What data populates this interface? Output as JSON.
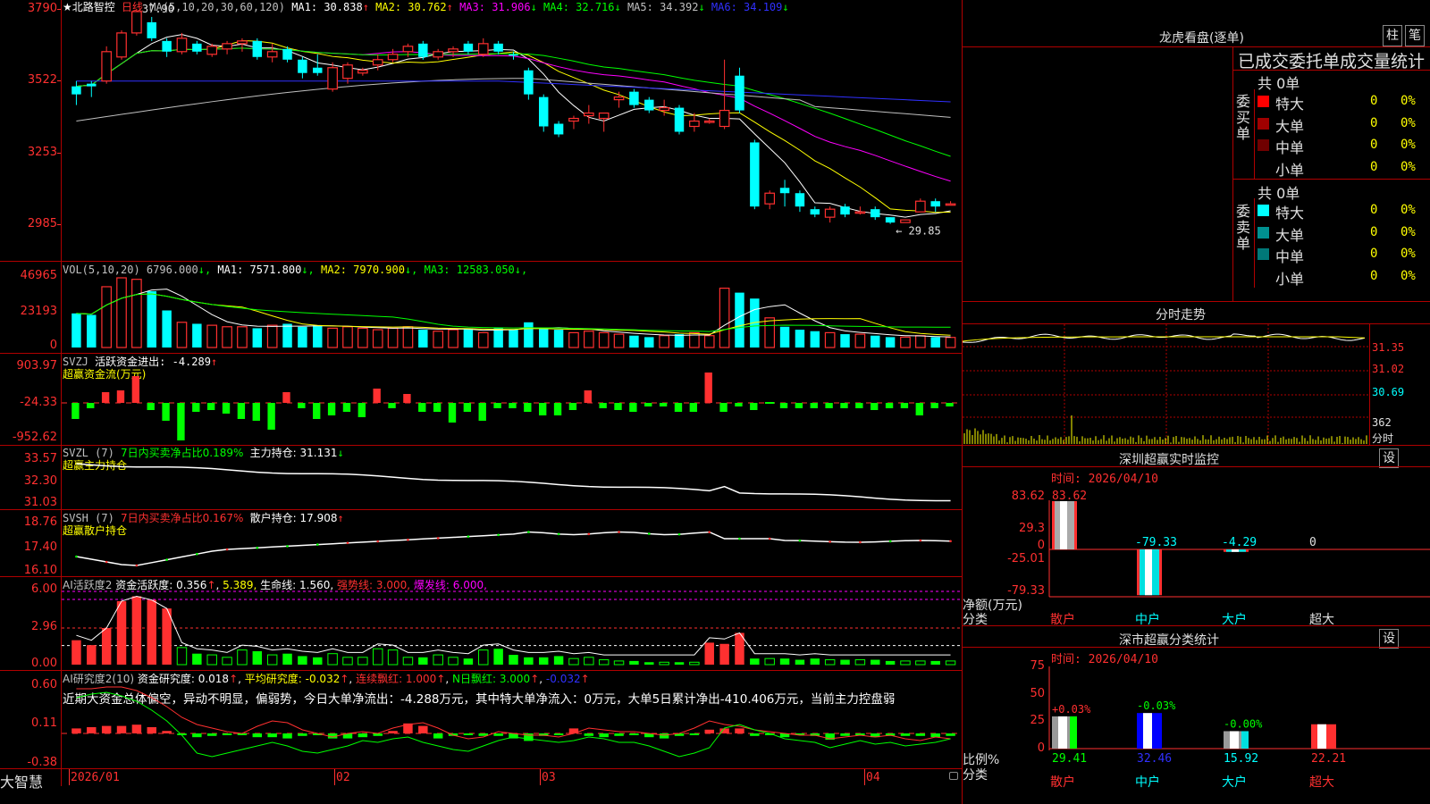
{
  "header": {
    "stock": "★北路智控",
    "period": "日线",
    "ma_label": "MA(5,10,20,30,60,120)",
    "ma": [
      {
        "name": "MA1: 30.838",
        "arrow": "↑",
        "color": "#ffffff"
      },
      {
        "name": "MA2: 30.762",
        "arrow": "↑",
        "color": "#ffff00"
      },
      {
        "name": "MA3: 31.906",
        "arrow": "↓",
        "color": "#ff00ff"
      },
      {
        "name": "MA4: 32.716",
        "arrow": "↓",
        "color": "#00ff00"
      },
      {
        "name": "MA5: 34.392",
        "arrow": "↓",
        "color": "#c0c0c0"
      },
      {
        "name": "MA6: 34.109",
        "arrow": "↓",
        "color": "#3030ff"
      }
    ]
  },
  "colors": {
    "up": "#ff3030",
    "down": "#00ffff",
    "panel_line": "#b00000",
    "green": "#00ff00"
  },
  "price_panel": {
    "ticks": [
      "3790",
      "3522",
      "3253",
      "2985"
    ],
    "tick_values": [
      37.9,
      35.22,
      32.53,
      29.85
    ],
    "ylim": [
      28.8,
      38.1
    ],
    "hi_label": "37.90",
    "lo_label": "29.85",
    "hi_value": 37.9,
    "lo_value": 29.85
  },
  "chart_data": {
    "type": "candlestick",
    "candles": [
      [
        34.7,
        35.0,
        34.3,
        35.2,
        0
      ],
      [
        35.0,
        35.1,
        34.6,
        35.2,
        0
      ],
      [
        35.2,
        36.3,
        35.1,
        36.5,
        1
      ],
      [
        36.1,
        37.0,
        36.0,
        37.1,
        1
      ],
      [
        37.0,
        37.8,
        36.9,
        37.9,
        1
      ],
      [
        37.4,
        36.8,
        36.7,
        37.6,
        0
      ],
      [
        36.7,
        36.3,
        36.1,
        36.8,
        0
      ],
      [
        36.3,
        36.8,
        36.2,
        37.0,
        1
      ],
      [
        36.6,
        36.3,
        36.2,
        36.7,
        0
      ],
      [
        36.2,
        36.5,
        36.1,
        36.6,
        1
      ],
      [
        36.4,
        36.6,
        36.2,
        36.7,
        1
      ],
      [
        36.6,
        36.7,
        36.3,
        36.8,
        1
      ],
      [
        36.7,
        36.1,
        36.0,
        36.8,
        0
      ],
      [
        36.1,
        36.3,
        35.9,
        36.6,
        1
      ],
      [
        36.4,
        36.0,
        35.9,
        36.5,
        0
      ],
      [
        36.0,
        35.5,
        35.3,
        36.1,
        0
      ],
      [
        35.7,
        35.5,
        35.4,
        36.2,
        0
      ],
      [
        34.9,
        35.7,
        34.8,
        35.9,
        1
      ],
      [
        35.3,
        35.8,
        35.1,
        35.9,
        1
      ],
      [
        35.5,
        35.6,
        35.4,
        35.7,
        1
      ],
      [
        35.8,
        36.0,
        35.6,
        36.2,
        1
      ],
      [
        36.0,
        36.2,
        35.9,
        36.4,
        1
      ],
      [
        36.3,
        36.5,
        36.1,
        36.6,
        1
      ],
      [
        36.6,
        36.1,
        36.0,
        36.7,
        0
      ],
      [
        36.1,
        36.3,
        36.0,
        36.4,
        1
      ],
      [
        36.3,
        36.4,
        36.1,
        36.5,
        1
      ],
      [
        36.6,
        36.3,
        36.2,
        36.7,
        0
      ],
      [
        36.2,
        36.6,
        36.1,
        36.8,
        1
      ],
      [
        36.6,
        36.3,
        36.2,
        36.7,
        0
      ],
      [
        36.2,
        36.2,
        36.0,
        36.3,
        0
      ],
      [
        35.6,
        34.7,
        34.5,
        35.7,
        0
      ],
      [
        34.6,
        33.5,
        33.3,
        34.7,
        0
      ],
      [
        33.6,
        33.2,
        33.1,
        33.7,
        0
      ],
      [
        33.7,
        33.8,
        33.4,
        33.9,
        1
      ],
      [
        33.9,
        34.0,
        33.6,
        34.3,
        1
      ],
      [
        33.8,
        34.0,
        33.3,
        34.0,
        1
      ],
      [
        34.5,
        34.6,
        34.2,
        34.8,
        1
      ],
      [
        34.8,
        34.3,
        34.2,
        34.9,
        0
      ],
      [
        34.5,
        34.1,
        34.0,
        34.6,
        0
      ],
      [
        34.1,
        34.2,
        33.9,
        34.5,
        1
      ],
      [
        34.2,
        33.3,
        33.2,
        34.3,
        0
      ],
      [
        33.5,
        33.7,
        33.3,
        34.0,
        1
      ],
      [
        33.7,
        33.7,
        33.6,
        33.8,
        1
      ],
      [
        33.5,
        34.1,
        33.4,
        36.0,
        1
      ],
      [
        35.4,
        34.1,
        34.0,
        35.7,
        0
      ],
      [
        32.9,
        30.5,
        30.4,
        33.0,
        0
      ],
      [
        30.6,
        31.0,
        30.4,
        31.1,
        1
      ],
      [
        31.2,
        31.0,
        30.5,
        31.5,
        0
      ],
      [
        31.0,
        30.5,
        30.3,
        31.1,
        0
      ],
      [
        30.4,
        30.2,
        30.1,
        30.5,
        0
      ],
      [
        30.1,
        30.4,
        29.9,
        30.5,
        1
      ],
      [
        30.5,
        30.2,
        30.1,
        30.6,
        0
      ],
      [
        30.3,
        30.3,
        30.2,
        30.5,
        1
      ],
      [
        30.4,
        30.1,
        30.0,
        30.5,
        0
      ],
      [
        30.1,
        29.9,
        29.85,
        30.1,
        0
      ],
      [
        29.9,
        30.0,
        29.9,
        30.0,
        1
      ],
      [
        30.3,
        30.7,
        30.3,
        30.8,
        1
      ],
      [
        30.7,
        30.5,
        30.3,
        30.8,
        0
      ],
      [
        30.6,
        30.6,
        30.6,
        30.7,
        1
      ]
    ],
    "volume": [
      {
        "label": "VOL(5,10,20)",
        "value": "6796.000",
        "arrow": "↓",
        "color": "#c0c0c0"
      },
      {
        "label": "MA1: 7571.800",
        "arrow": "↓",
        "color": "#ffffff"
      },
      {
        "label": "MA2: 7970.900",
        "arrow": "↓",
        "color": "#ffff00"
      },
      {
        "label": "MA3: 12583.050",
        "arrow": "↓",
        "color": "#00ff00"
      }
    ],
    "volume_ticks": [
      "46965",
      "23193",
      "0"
    ],
    "volume_values": [
      23000,
      22000,
      41000,
      47000,
      46000,
      38000,
      25000,
      17000,
      16000,
      15000,
      14000,
      14000,
      13000,
      15000,
      16000,
      14000,
      15000,
      13000,
      14000,
      13000,
      12000,
      13000,
      14000,
      12000,
      11000,
      12000,
      13000,
      10000,
      13000,
      12000,
      17000,
      13000,
      12000,
      10000,
      11000,
      10000,
      9000,
      8000,
      7000,
      8000,
      9000,
      10000,
      8000,
      40000,
      37000,
      33000,
      20000,
      14000,
      12000,
      11000,
      10000,
      9000,
      9000,
      8000,
      7000,
      7000,
      8000,
      7000,
      6796
    ]
  },
  "svzj": {
    "label": "SVZJ",
    "title": "活跃资金进出: -4.289",
    "arrow": "↑",
    "sub": "超赢资金流(万元)",
    "ticks": [
      "903.97",
      "-24.33",
      "-952.62"
    ]
  },
  "svzl": {
    "label": "SVZL (7)",
    "p1": "7日内买卖净占比0.189%",
    "p2": "主力持仓: 31.131",
    "arrow": "↓",
    "sub": "超赢主力持仓",
    "ticks": [
      "33.57",
      "32.30",
      "31.03"
    ]
  },
  "svsh": {
    "label": "SVSH (7)",
    "p1": "7日内买卖净占比0.167%",
    "p2": "散户持仓: 17.908",
    "arrow": "↑",
    "sub": "超赢散户持仓",
    "ticks": [
      "18.76",
      "17.40",
      "16.10"
    ]
  },
  "ai1": {
    "label": "AI活跃度2",
    "t1": "资金活跃度: 0.356",
    "a1": "↑",
    "t2": "5.389",
    "t3": "生命线: 1.560",
    "t4": "强势线: 3.000",
    "t5": "爆发线: 6.000",
    "ticks": [
      "6.00",
      "2.96",
      "0.00"
    ]
  },
  "ai2": {
    "label": "AI研究度2(10)",
    "t1": "资金研究度: 0.018",
    "a1": "↑",
    "t2": "平均研究度: -0.032",
    "a2": "↑",
    "t3": "连续飘红: 1.000",
    "a3": "↑",
    "t4": "N日飘红: 3.000",
    "a4": "↑",
    "t5": "-0.032",
    "a5": "↑",
    "desc": "近期大资金总体偏空，异动不明显，偏弱势，今日大单净流出：-4.288万元，其中特大单净流入：0万元，大单5日累计净出-410.406万元，当前主力控盘弱",
    "ticks": [
      "0.60",
      "0.11",
      "-0.38"
    ]
  },
  "xaxis": {
    "labels": [
      "2026/01",
      "02",
      "03",
      "04"
    ],
    "brand": "大智慧"
  },
  "right": {
    "lhkp_title": "龙虎看盘(逐单)",
    "btn1": "柱",
    "btn2": "笔",
    "stat_title": "已成交委托单成交量统计",
    "buy_total": "共 0单",
    "sell_total": "共 0单",
    "buy_side": "委买单",
    "sell_side": "委卖单",
    "rows": [
      {
        "name": "特大",
        "v": "0",
        "p": "0%",
        "buy": "#ff0000",
        "sell": "#00ffff"
      },
      {
        "name": "大单",
        "v": "0",
        "p": "0%",
        "buy": "#a00000",
        "sell": "#009090"
      },
      {
        "name": "中单",
        "v": "0",
        "p": "0%",
        "buy": "#700000",
        "sell": "#007878"
      },
      {
        "name": "小单",
        "v": "0",
        "p": "0%",
        "buy": "",
        "sell": ""
      }
    ],
    "fs_title": "分时走势",
    "fs_ticks": [
      "31.35",
      "31.02",
      "30.69",
      "362",
      "分时"
    ],
    "sz_title": "深圳超赢实时监控",
    "set_label": "设",
    "sz_time": "时间: 2026/04/10",
    "sz_ticks": [
      "83.62",
      "29.3",
      "0",
      "-25.01",
      "-79.33"
    ],
    "sz_unit": "净额(万元)",
    "sz_cat_label": "分类",
    "sz_cats": [
      "散户",
      "中户",
      "大户",
      "超大"
    ],
    "sz_values": [
      83.62,
      -79.33,
      -4.29,
      0
    ],
    "sz_value_labels": [
      "83.62",
      "-79.33",
      "-4.29",
      "0"
    ],
    "ss_title": "深市超赢分类统计",
    "ss_time": "时间: 2026/04/10",
    "ss_ticks": [
      "75",
      "50",
      "25",
      "0"
    ],
    "ss_unit": "比例%",
    "ss_cat_label": "分类",
    "ss_cats": [
      "散户",
      "中户",
      "大户",
      "超大"
    ],
    "ss_values": [
      29.41,
      32.46,
      15.92,
      22.21
    ],
    "ss_deltas": [
      "+0.03%",
      "-0.03%",
      "-0.00%",
      ""
    ],
    "ss_value_labels": [
      "29.41",
      "32.46",
      "15.92",
      "22.21"
    ]
  }
}
